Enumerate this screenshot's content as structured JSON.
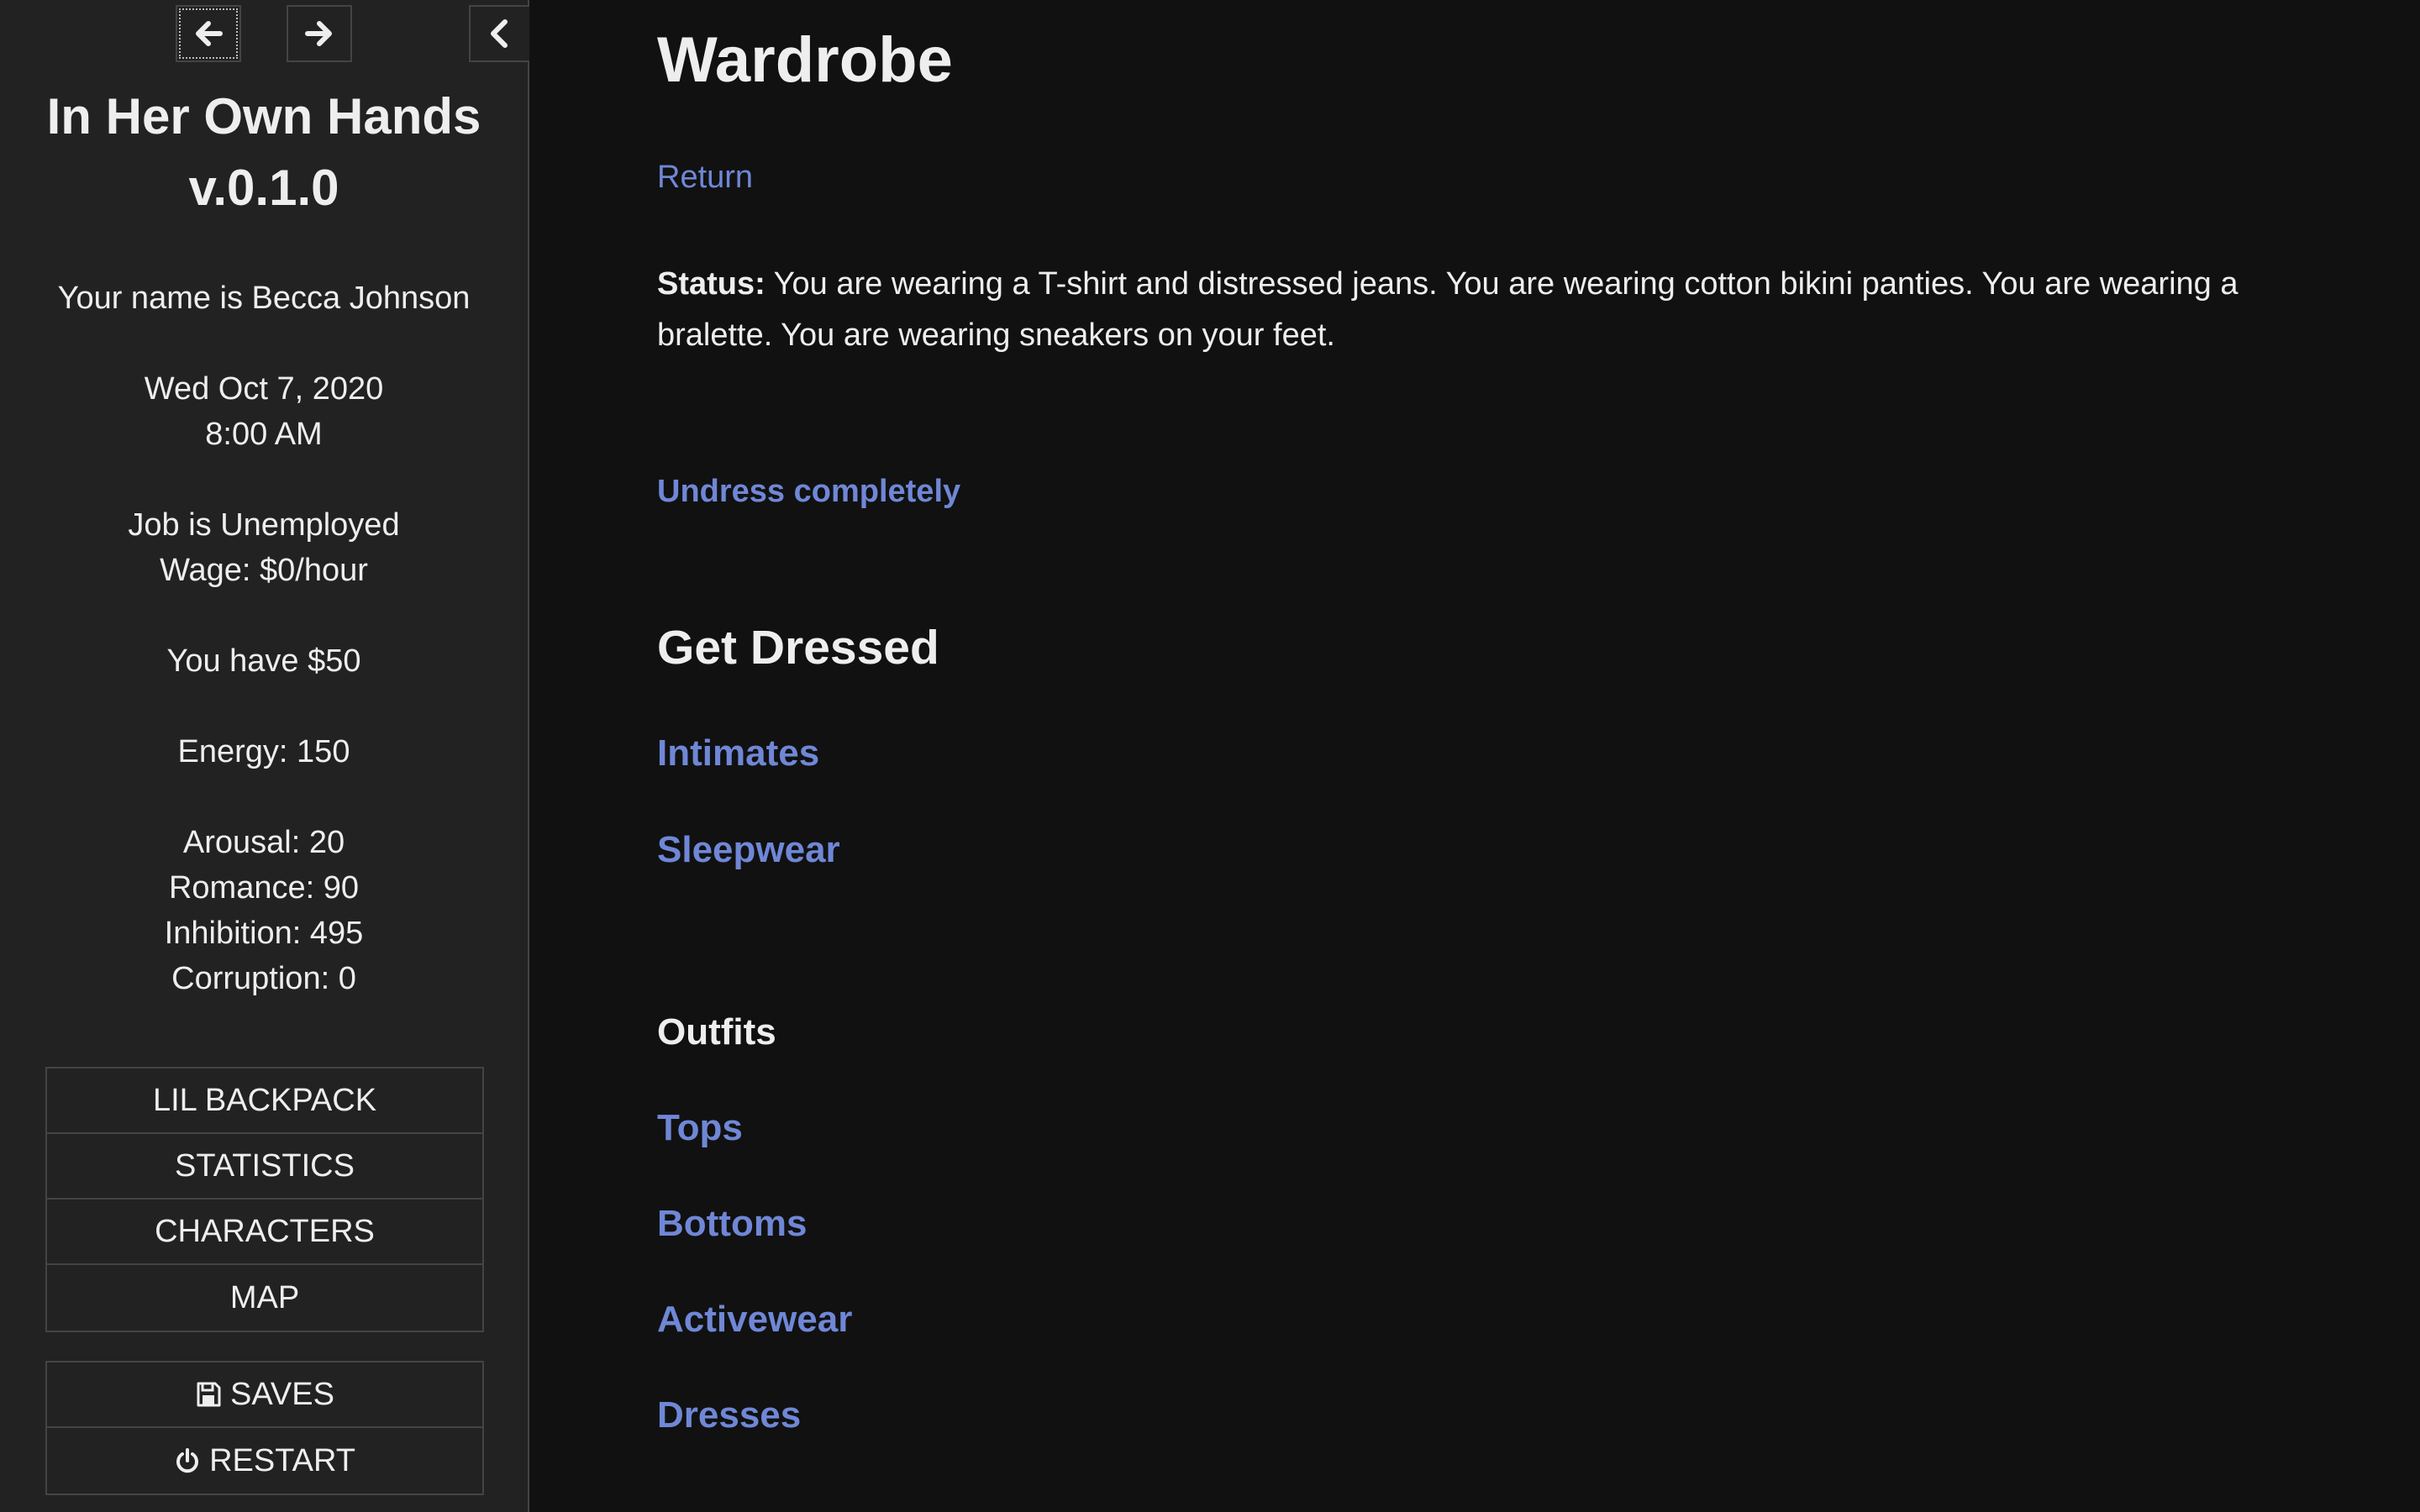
{
  "sidebar": {
    "title": "In Her Own Hands v.0.1.0",
    "name_line": "Your name is Becca Johnson",
    "date": "Wed Oct 7, 2020",
    "time": "8:00 AM",
    "job": "Job is Unemployed",
    "wage": "Wage: $0/hour",
    "money": "You have $50",
    "energy": "Energy: 150",
    "arousal": "Arousal: 20",
    "romance": "Romance: 90",
    "inhibition": "Inhibition: 495",
    "corruption": "Corruption: 0",
    "story_menu": [
      "LIL BACKPACK",
      "STATISTICS",
      "CHARACTERS",
      "MAP"
    ],
    "saves_label": "SAVES",
    "restart_label": "RESTART",
    "icons": {
      "back": "arrow-left-icon",
      "forward": "arrow-right-icon",
      "toggle": "chevron-left-icon",
      "saves": "floppy-disk-icon",
      "restart": "power-icon"
    }
  },
  "main": {
    "title": "Wardrobe",
    "return_label": "Return",
    "status_label": "Status:",
    "status_text": "You are wearing a T-shirt and distressed jeans. You are wearing cotton bikini panties. You are wearing a bralette. You are wearing sneakers on your feet.",
    "undress_label": "Undress completely",
    "get_dressed_heading": "Get Dressed",
    "get_dressed_links": [
      "Intimates",
      "Sleepwear"
    ],
    "outfits_heading": "Outfits",
    "outfit_links": [
      "Tops",
      "Bottoms",
      "Activewear",
      "Dresses"
    ]
  },
  "colors": {
    "background": "#111111",
    "sidebar": "#222222",
    "link": "#6f87d6",
    "text": "#eeeeee"
  }
}
